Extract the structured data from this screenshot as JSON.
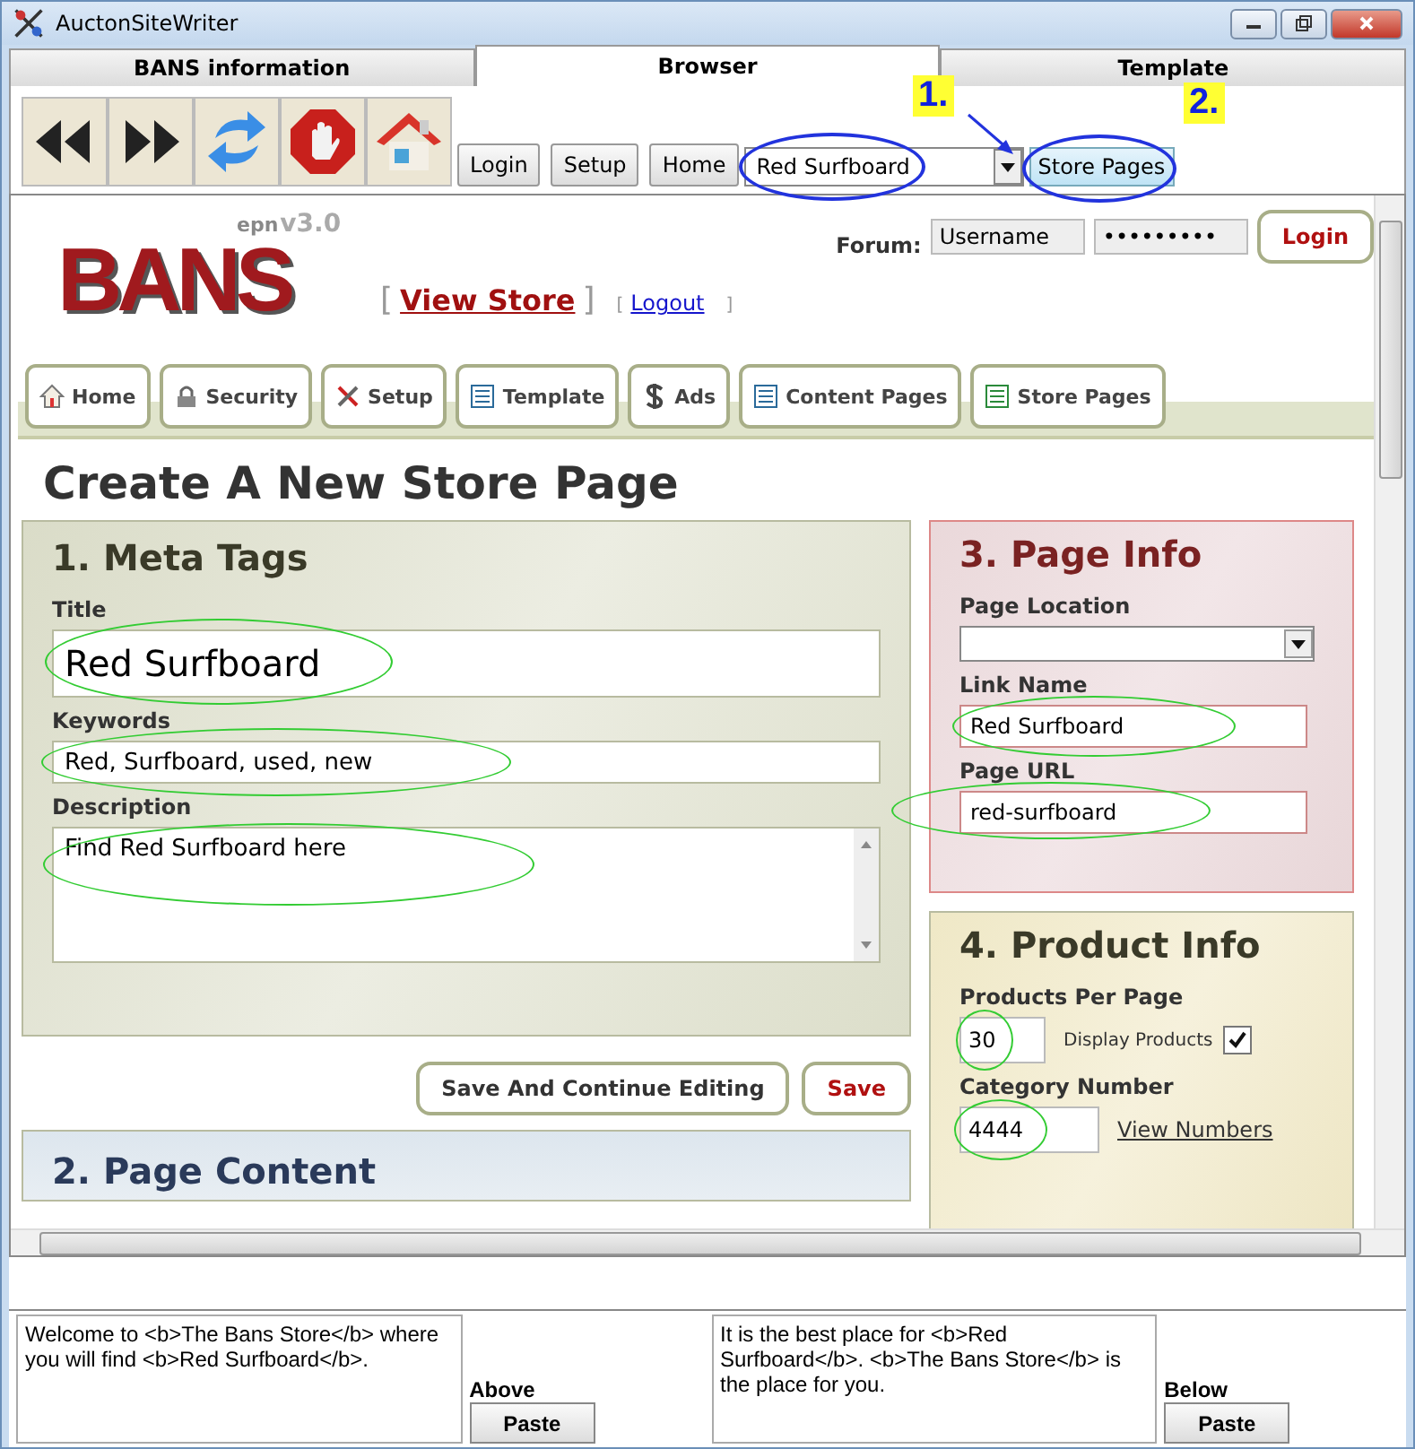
{
  "window": {
    "title": "AuctonSiteWriter"
  },
  "tabs": [
    {
      "label": "BANS information",
      "selected": false
    },
    {
      "label": "Browser",
      "selected": true
    },
    {
      "label": "Template",
      "selected": false
    }
  ],
  "toolbar": {
    "buttons": [
      "Login",
      "Setup",
      "Home"
    ],
    "page_combo": {
      "value": "Red Surfboard",
      "circled": true
    },
    "store_pages_button": {
      "label": "Store Pages",
      "circled": true
    },
    "callouts": [
      "1.",
      "2."
    ]
  },
  "web": {
    "logo": {
      "text": "BANS",
      "edition": "epn",
      "version": "v3.0"
    },
    "forum_label": "Forum:",
    "username": "Username",
    "password": "•••••••••",
    "login_button": "Login",
    "view_store": {
      "open": "[",
      "label": "View Store",
      "close": "]"
    },
    "logout": {
      "open": "[",
      "label": "Logout",
      "close": "]"
    },
    "nav_tabs": [
      "Home",
      "Security",
      "Setup",
      "Template",
      "Ads",
      "Content Pages",
      "Store Pages"
    ],
    "heading": "Create A New Store Page",
    "meta_tags": {
      "heading": "1. Meta Tags",
      "fields": [
        {
          "kind": "title",
          "label": "Title",
          "value": "Red Surfboard",
          "circled": true
        },
        {
          "kind": "input",
          "label": "Keywords",
          "value": "Red, Surfboard, used, new",
          "circled": true
        },
        {
          "kind": "textarea",
          "label": "Description",
          "value": "Find Red Surfboard here",
          "circled": true
        }
      ]
    },
    "actions": [
      {
        "kind": "normal",
        "label": "Save And Continue Editing"
      },
      {
        "kind": "primary",
        "label": "Save"
      }
    ],
    "page_content": {
      "heading": "2. Page Content"
    },
    "page_info": {
      "heading": "3. Page Info",
      "fields": [
        {
          "kind": "select",
          "label": "Page Location"
        },
        {
          "kind": "input",
          "label": "Link Name",
          "value": "Red Surfboard",
          "circled": true
        },
        {
          "kind": "input",
          "label": "Page URL",
          "value": "red-surfboard",
          "circled": true
        }
      ]
    },
    "product_info": {
      "heading": "4. Product Info",
      "products_per_page": {
        "label": "Products Per Page",
        "value": "30",
        "circled": true
      },
      "display_products": {
        "label": "Display Products",
        "checked": true
      },
      "category_number": {
        "label": "Category Number",
        "value": "4444",
        "circled": true
      },
      "view_numbers": "View Numbers"
    }
  },
  "bottom": {
    "above_text": "Welcome to <b>The Bans Store</b> where you will find <b>Red Surfboard</b>.",
    "above_label": "Above",
    "above_button": "Paste",
    "below_text": "It is the best place for <b>Red Surfboard</b>. <b>The Bans Store</b> is the place for you.",
    "below_label": "Below",
    "below_button": "Paste"
  }
}
